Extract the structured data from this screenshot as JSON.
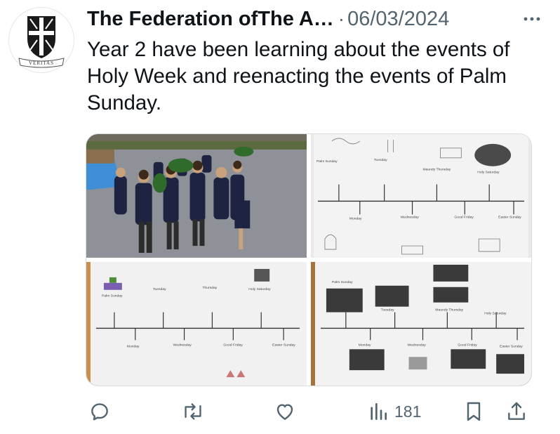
{
  "tweet": {
    "author_name": "The Federation ofThe A…",
    "separator": "·",
    "date": "06/03/2024",
    "text": "Year 2 have been learning about the events of Holy Week and reenacting the events of Palm Sunday.",
    "avatar": {
      "logo_text": "VERITAS",
      "icon": "shield-cross-crest"
    }
  },
  "media": [
    {
      "name": "children-reenacting-palm-sunday-photo",
      "kind": "photo"
    },
    {
      "name": "holy-week-timeline-worksheet-1",
      "kind": "worksheet",
      "labels": [
        "Palm Sunday",
        "Tuesday",
        "Maundy Thursday",
        "Holy Saturday",
        "Monday",
        "Wednesday",
        "Good Friday",
        "Easter Sunday"
      ]
    },
    {
      "name": "holy-week-timeline-worksheet-2",
      "kind": "worksheet",
      "labels": [
        "Palm Sunday",
        "Tuesday",
        "Thursday",
        "Holy Saturday",
        "Monday",
        "Wednesday",
        "Good Friday",
        "Easter Sunday"
      ]
    },
    {
      "name": "holy-week-timeline-picture-worksheet",
      "kind": "worksheet",
      "labels": [
        "Palm Sunday",
        "Tuesday",
        "Maundy Thursday",
        "Holy Saturday",
        "Monday",
        "Wednesday",
        "Good Friday",
        "Easter Sunday"
      ]
    }
  ],
  "actions": {
    "reply_icon": "reply-icon",
    "retweet_icon": "retweet-icon",
    "like_icon": "like-icon",
    "views_icon": "views-icon",
    "views_count": "181",
    "bookmark_icon": "bookmark-icon",
    "share_icon": "share-icon"
  },
  "colors": {
    "text": "#0f1419",
    "secondary": "#536471",
    "border": "#d8dde1"
  }
}
